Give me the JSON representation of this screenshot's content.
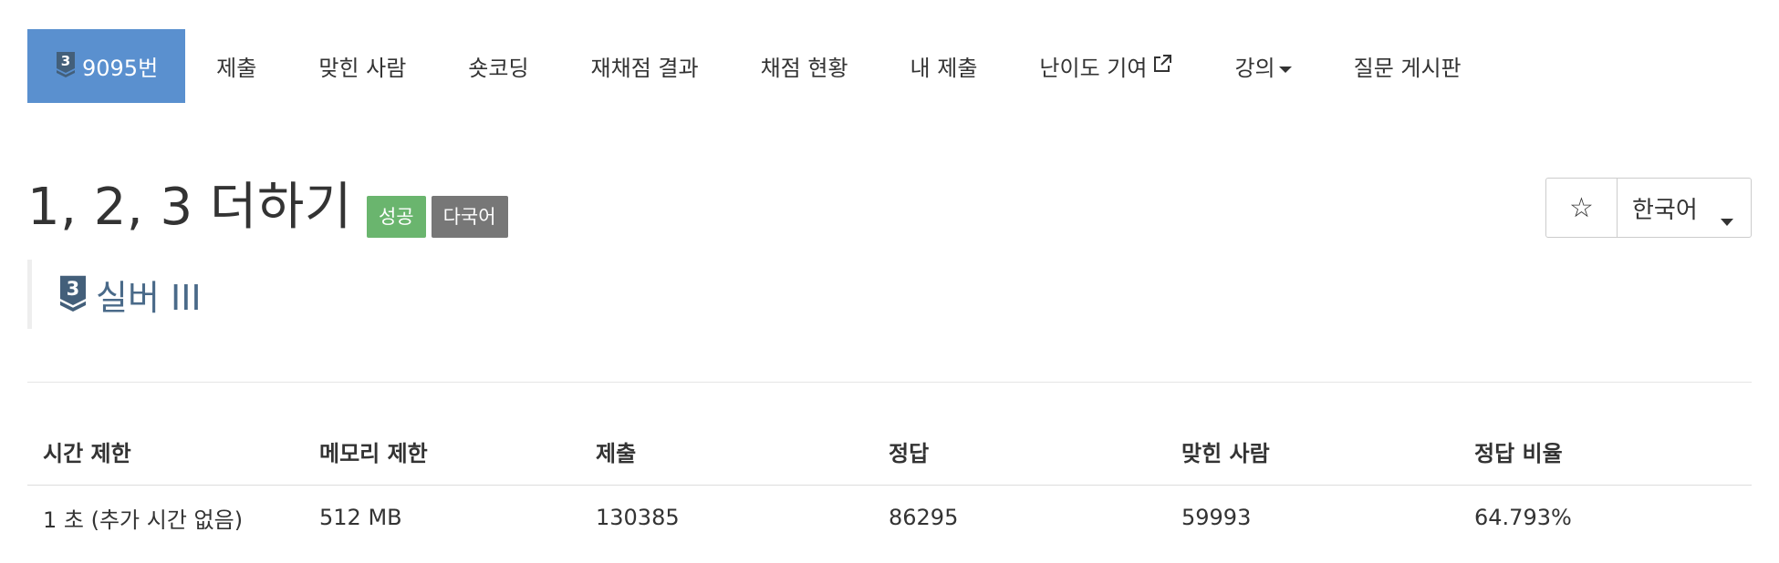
{
  "nav": {
    "items": [
      {
        "label": "9095번",
        "active": true,
        "tier_digit": "3"
      },
      {
        "label": "제출"
      },
      {
        "label": "맞힌 사람"
      },
      {
        "label": "숏코딩"
      },
      {
        "label": "재채점 결과"
      },
      {
        "label": "채점 현황"
      },
      {
        "label": "내 제출"
      },
      {
        "label": "난이도 기여",
        "icon": "external-link-icon"
      },
      {
        "label": "강의",
        "icon": "caret-down-icon"
      },
      {
        "label": "질문 게시판"
      }
    ]
  },
  "problem": {
    "title": "1, 2, 3 더하기",
    "labels": {
      "success": "성공",
      "multilang": "다국어"
    },
    "tier": {
      "digit": "3",
      "name": "실버 III"
    }
  },
  "controls": {
    "star_icon": "star-outline-icon",
    "star_glyph": "☆",
    "language": "한국어"
  },
  "info_table": {
    "headers": [
      "시간 제한",
      "메모리 제한",
      "제출",
      "정답",
      "맞힌 사람",
      "정답 비율"
    ],
    "row": [
      "1 초 (추가 시간 없음)",
      "512 MB",
      "130385",
      "86295",
      "59993",
      "64.793%"
    ]
  },
  "colors": {
    "active_nav": "#5a90cf",
    "label_success": "#6ab56e",
    "label_default": "#777777",
    "tier_badge": "#435f7a",
    "tier_text": "#4a6a89"
  }
}
